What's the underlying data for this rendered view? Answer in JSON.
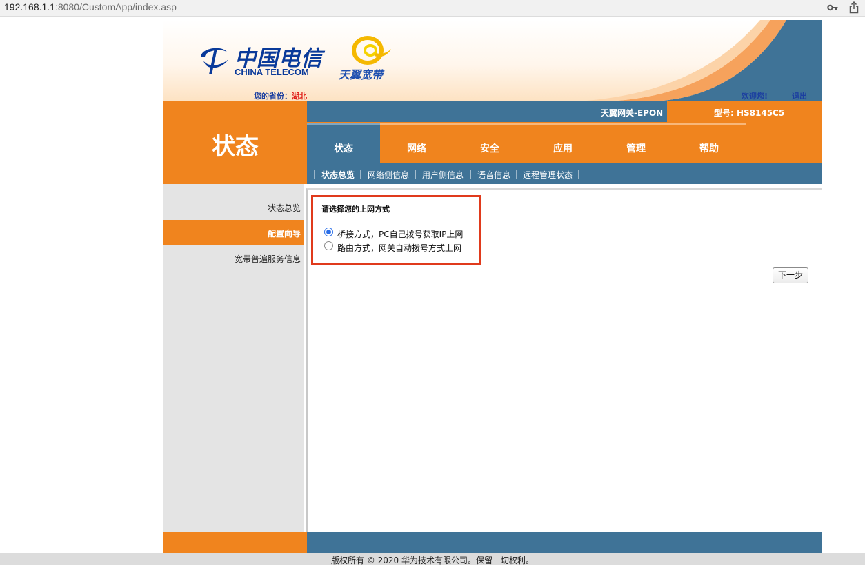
{
  "browser": {
    "url_host": "192.168.1.1",
    "url_rest": ":8080/CustomApp/index.asp"
  },
  "banner": {
    "logo_cn": "中国电信",
    "logo_en": "CHINA TELECOM",
    "tianyi": "天翼宽带",
    "province_label": "您的省份：",
    "province_value": "湖北",
    "welcome": "欢迎您!",
    "logout": "退出"
  },
  "header": {
    "page_title": "状态",
    "gateway": "天翼网关-EPON",
    "model": "型号: HS8145C5"
  },
  "nav": {
    "tabs": [
      {
        "label": "状态",
        "active": true
      },
      {
        "label": "网络",
        "active": false
      },
      {
        "label": "安全",
        "active": false
      },
      {
        "label": "应用",
        "active": false
      },
      {
        "label": "管理",
        "active": false
      },
      {
        "label": "帮助",
        "active": false
      }
    ]
  },
  "subnav": {
    "items": [
      {
        "label": "状态总览",
        "active": true
      },
      {
        "label": "网络侧信息",
        "active": false
      },
      {
        "label": "用户侧信息",
        "active": false
      },
      {
        "label": "语音信息",
        "active": false
      },
      {
        "label": "远程管理状态",
        "active": false
      }
    ],
    "separator": "|"
  },
  "sidebar": {
    "items": [
      {
        "label": "状态总览",
        "active": false
      },
      {
        "label": "配置向导",
        "active": true
      },
      {
        "label": "宽带普遍服务信息",
        "active": false
      }
    ]
  },
  "wizard": {
    "title": "请选择您的上网方式",
    "options": [
      {
        "label": "桥接方式，PC自己拨号获取IP上网",
        "selected": true
      },
      {
        "label": "路由方式，网关自动拨号方式上网",
        "selected": false
      }
    ],
    "next_button": "下一步"
  },
  "footer": {
    "copyright": "版权所有 © 2020 华为技术有限公司。保留一切权利。"
  },
  "colors": {
    "orange": "#f0841e",
    "steel_blue": "#3f7397",
    "brand_blue": "#0a3a9a",
    "highlight_red": "#e03a1c"
  }
}
